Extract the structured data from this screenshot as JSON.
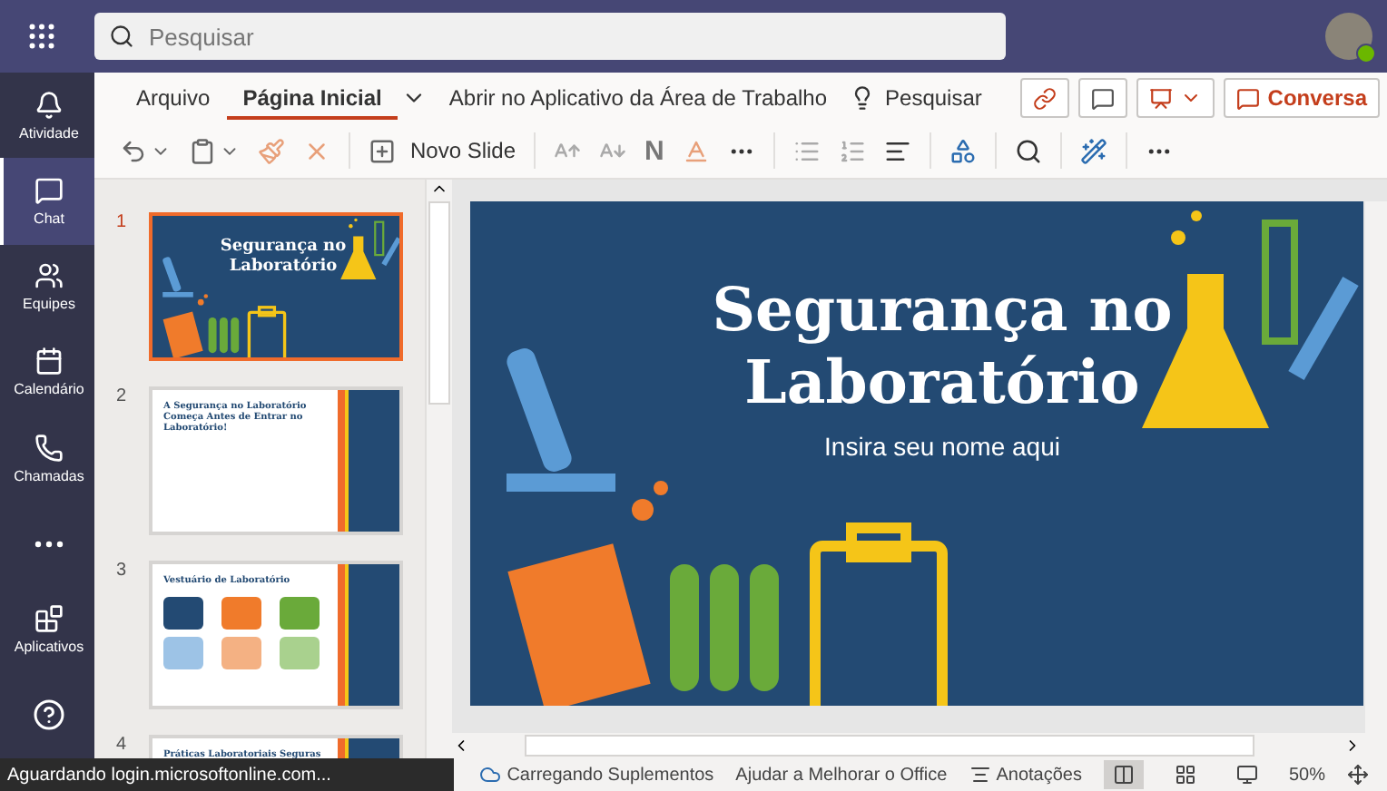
{
  "top_bar": {
    "search": {
      "placeholder": "Pesquisar"
    }
  },
  "rail": {
    "items": [
      {
        "label": "Atividade",
        "selected": false
      },
      {
        "label": "Chat",
        "selected": true
      },
      {
        "label": "Equipes",
        "selected": false
      },
      {
        "label": "Calendário",
        "selected": false
      },
      {
        "label": "Chamadas",
        "selected": false
      },
      {
        "selected": false
      }
    ],
    "apps_label": "Aplicativos"
  },
  "ribbon": {
    "tabs": [
      {
        "label": "Arquivo",
        "selected": false
      },
      {
        "label": "Página Inicial",
        "selected": true
      }
    ],
    "open_desktop": "Abrir no Aplicativo da Área de Trabalho",
    "search": "Pesquisar",
    "conversation_button": "Conversa",
    "new_slide": "Novo Slide",
    "bold": "N"
  },
  "slides": [
    {
      "number": "1",
      "selected": true,
      "kind": "title",
      "title": "Segurança no Laboratório"
    },
    {
      "number": "2",
      "selected": false,
      "kind": "text",
      "title": "A Segurança no Laboratório Começa Antes de Entrar no Laboratório!"
    },
    {
      "number": "3",
      "selected": false,
      "kind": "grid",
      "title": "Vestuário de Laboratório"
    },
    {
      "number": "4",
      "selected": false,
      "kind": "text",
      "title": "Práticas Laboratoriais Seguras"
    }
  ],
  "current_slide": {
    "title": "Segurança no Laboratório",
    "subtitle": "Insira seu nome aqui"
  },
  "status_bar": {
    "tooltip": "Aguardando login.microsoftonline.com...",
    "addins": "Carregando Suplementos",
    "help": "Ajudar a Melhorar o Office",
    "notes": "Anotações",
    "views": [
      {
        "selected": true
      },
      {
        "selected": false
      },
      {
        "selected": false
      }
    ],
    "zoom": "50%"
  }
}
